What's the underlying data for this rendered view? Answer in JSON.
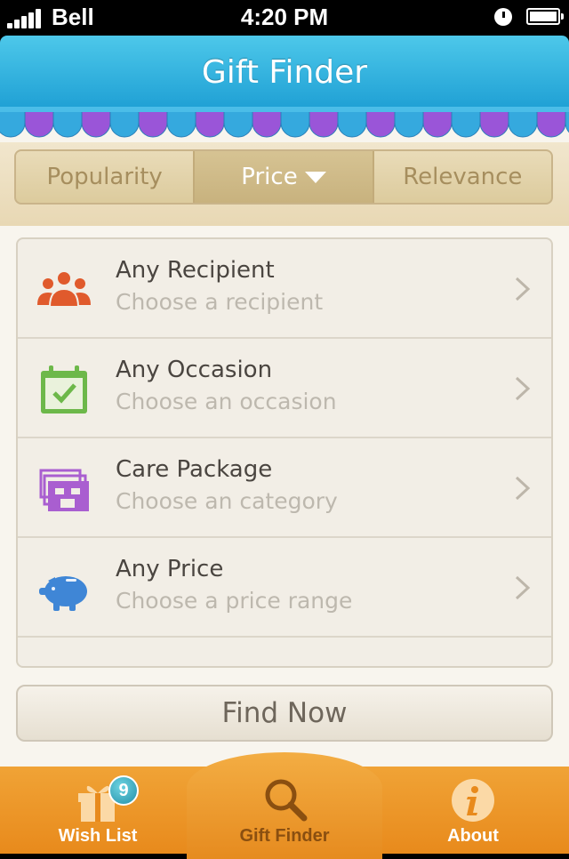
{
  "status": {
    "carrier": "Bell",
    "time": "4:20 PM"
  },
  "nav": {
    "title": "Gift Finder"
  },
  "sort": {
    "options": [
      "Popularity",
      "Price",
      "Relevance"
    ],
    "selected": "Price"
  },
  "filters": [
    {
      "title": "Any Recipient",
      "subtitle": "Choose a recipient",
      "icon": "people-icon"
    },
    {
      "title": "Any Occasion",
      "subtitle": "Choose an occasion",
      "icon": "calendar-check-icon"
    },
    {
      "title": "Care Package",
      "subtitle": "Choose an category",
      "icon": "package-stack-icon"
    },
    {
      "title": "Any Price",
      "subtitle": "Choose a price range",
      "icon": "piggy-bank-icon"
    }
  ],
  "find_button": "Find Now",
  "tabs": [
    {
      "label": "Wish List",
      "icon": "gift-icon",
      "badge": "9"
    },
    {
      "label": "Gift Finder",
      "icon": "magnifier-icon"
    },
    {
      "label": "About",
      "icon": "info-icon"
    }
  ],
  "colors": {
    "nav": "#29aee0",
    "tabbar": "#ec9528",
    "accent_orange": "#e05a2c",
    "occasion_green": "#6db84a",
    "package_purple": "#a95ed0",
    "price_blue": "#3f86d6"
  }
}
